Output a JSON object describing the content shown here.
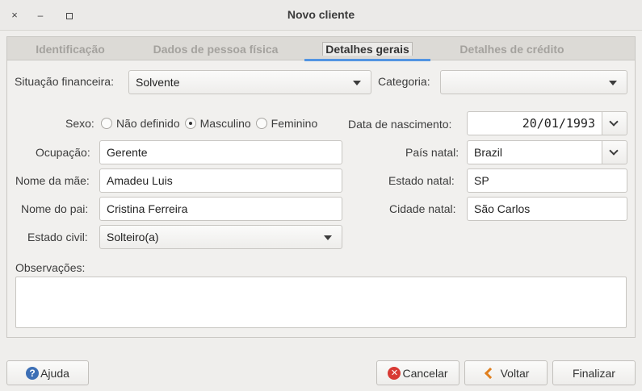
{
  "window": {
    "title": "Novo cliente",
    "close_glyph": "×",
    "min_glyph": "–"
  },
  "tabs": [
    {
      "label": "Identificação"
    },
    {
      "label": "Dados de pessoa física"
    },
    {
      "label": "Detalhes gerais"
    },
    {
      "label": "Detalhes de crédito"
    }
  ],
  "form": {
    "situacao_label": "Situação financeira:",
    "situacao_value": "Solvente",
    "categoria_label": "Categoria:",
    "categoria_value": "",
    "sexo_label": "Sexo:",
    "sexo_options": [
      {
        "label": "Não definido",
        "checked": false
      },
      {
        "label": "Masculino",
        "checked": true
      },
      {
        "label": "Feminino",
        "checked": false
      }
    ],
    "ocupacao_label": "Ocupação:",
    "ocupacao_value": "Gerente",
    "nome_mae_label": "Nome da mãe:",
    "nome_mae_value": "Amadeu Luis",
    "nome_pai_label": "Nome do pai:",
    "nome_pai_value": "Cristina Ferreira",
    "estado_civil_label": "Estado civil:",
    "estado_civil_value": "Solteiro(a)",
    "data_nasc_label": "Data de nascimento:",
    "data_nasc_value": "20/01/1993",
    "pais_label": "País natal:",
    "pais_value": "Brazil",
    "estado_natal_label": "Estado natal:",
    "estado_natal_value": "SP",
    "cidade_label": "Cidade natal:",
    "cidade_value": "São Carlos",
    "observacoes_label": "Observações:",
    "observacoes_value": ""
  },
  "buttons": {
    "help": "Ajuda",
    "help_glyph": "?",
    "cancel": "Cancelar",
    "cancel_glyph": "✕",
    "back": "Voltar",
    "finish": "Finalizar"
  },
  "colors": {
    "accent": "#5294e2",
    "help_icon": "#3d6fb5",
    "cancel_icon": "#d83a34",
    "back_icon": "#e07f1e"
  }
}
